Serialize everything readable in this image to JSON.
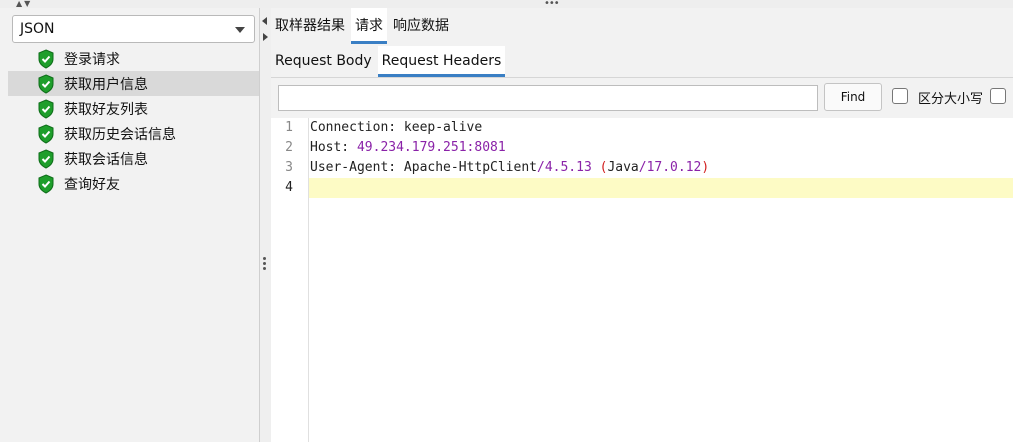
{
  "left_panel": {
    "renderer": "JSON",
    "tree_items": [
      {
        "label": "登录请求",
        "selected": false
      },
      {
        "label": "获取用户信息",
        "selected": true
      },
      {
        "label": "获取好友列表",
        "selected": false
      },
      {
        "label": "获取历史会话信息",
        "selected": false
      },
      {
        "label": "获取会话信息",
        "selected": false
      },
      {
        "label": "查询好友",
        "selected": false
      }
    ]
  },
  "main_tabs": [
    {
      "label": "取样器结果",
      "active": false
    },
    {
      "label": "请求",
      "active": true
    },
    {
      "label": "响应数据",
      "active": false
    }
  ],
  "sub_tabs": [
    {
      "label": "Request Body",
      "active": false
    },
    {
      "label": "Request Headers",
      "active": true
    }
  ],
  "find": {
    "input_value": "",
    "button_label": "Find",
    "case_sensitive_label": "区分大小写",
    "case_sensitive_checked": false,
    "regex_checked": false
  },
  "editor": {
    "line_numbers": [
      "1",
      "2",
      "3",
      "4"
    ],
    "current_line": 4,
    "line1": {
      "key": "Connection: ",
      "value": "keep-alive"
    },
    "line2": {
      "key": "Host: ",
      "value": "49.234.179.251:8081"
    },
    "line3": {
      "key": "User-Agent: ",
      "product": "Apache-HttpClient",
      "slash1": "/",
      "version": "4.5.13",
      "space": " ",
      "open_paren": "(",
      "java": "Java",
      "slash2": "/",
      "java_version": "17.0.12",
      "close_paren": ")"
    }
  },
  "colors": {
    "accent": "#3a7fc4",
    "number": "#8a22a8",
    "paren": "#d21f1f",
    "current_line": "#fdfbc5",
    "success_icon": "#1e9e2b"
  }
}
